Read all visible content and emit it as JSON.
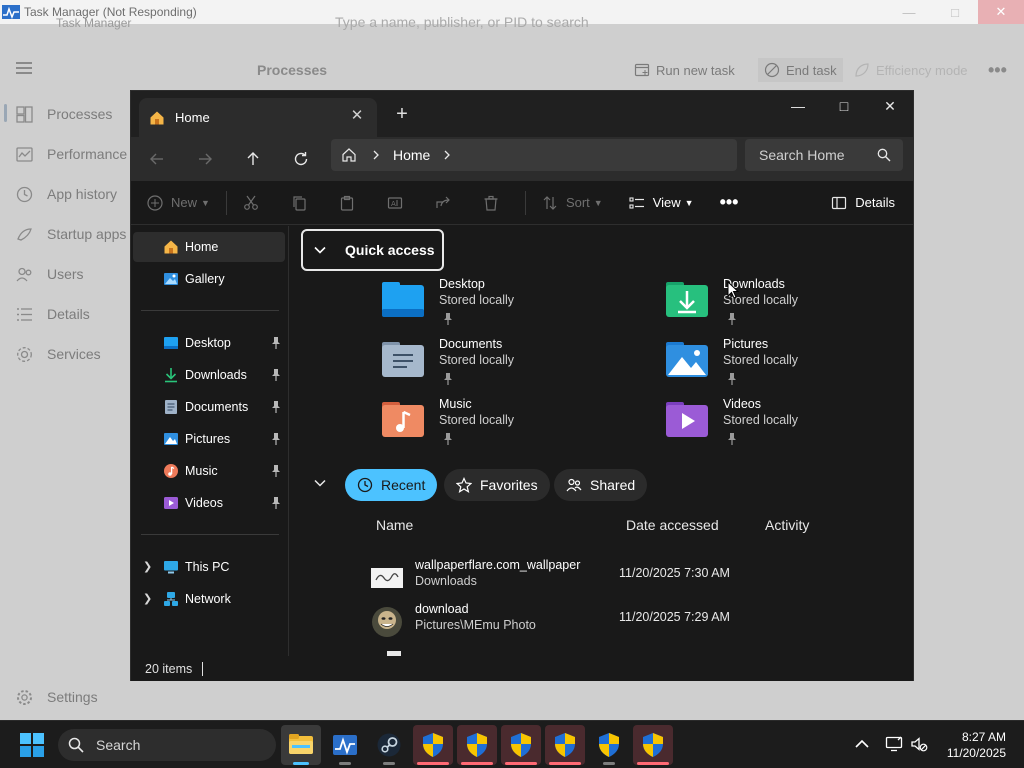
{
  "task_manager": {
    "title": "Task Manager (Not Responding)",
    "ghost_app_name": "Task Manager",
    "search_placeholder": "Type a name, publisher, or PID to search",
    "page_title": "Processes",
    "toolbar": {
      "run_new_task": "Run new task",
      "end_task": "End task",
      "efficiency_mode": "Efficiency mode"
    },
    "nav": [
      {
        "label": "Processes",
        "icon": "processes-icon"
      },
      {
        "label": "Performance",
        "icon": "performance-icon"
      },
      {
        "label": "App history",
        "icon": "app-history-icon"
      },
      {
        "label": "Startup apps",
        "icon": "startup-icon"
      },
      {
        "label": "Users",
        "icon": "users-icon"
      },
      {
        "label": "Details",
        "icon": "details-icon"
      },
      {
        "label": "Services",
        "icon": "services-icon"
      }
    ],
    "settings_label": "Settings"
  },
  "explorer": {
    "tab_title": "Home",
    "breadcrumb": "Home",
    "search_placeholder": "Search Home",
    "commands": {
      "new": "New",
      "sort": "Sort",
      "view": "View",
      "details": "Details"
    },
    "sidebar": {
      "top": [
        {
          "label": "Home",
          "icon": "home-icon"
        },
        {
          "label": "Gallery",
          "icon": "gallery-icon"
        }
      ],
      "pinned": [
        {
          "label": "Desktop",
          "icon": "desktop-folder-icon"
        },
        {
          "label": "Downloads",
          "icon": "downloads-folder-icon"
        },
        {
          "label": "Documents",
          "icon": "documents-folder-icon"
        },
        {
          "label": "Pictures",
          "icon": "pictures-folder-icon"
        },
        {
          "label": "Music",
          "icon": "music-folder-icon"
        },
        {
          "label": "Videos",
          "icon": "videos-folder-icon"
        }
      ],
      "devices": [
        {
          "label": "This PC",
          "icon": "this-pc-icon"
        },
        {
          "label": "Network",
          "icon": "network-icon"
        }
      ]
    },
    "quick_access": {
      "title": "Quick access",
      "folders": [
        {
          "name": "Desktop",
          "sub": "Stored locally"
        },
        {
          "name": "Downloads",
          "sub": "Stored locally"
        },
        {
          "name": "Documents",
          "sub": "Stored locally"
        },
        {
          "name": "Pictures",
          "sub": "Stored locally"
        },
        {
          "name": "Music",
          "sub": "Stored locally"
        },
        {
          "name": "Videos",
          "sub": "Stored locally"
        }
      ]
    },
    "filters": {
      "recent": "Recent",
      "favorites": "Favorites",
      "shared": "Shared"
    },
    "columns": {
      "name": "Name",
      "date": "Date accessed",
      "activity": "Activity"
    },
    "files": [
      {
        "name": "wallpaperflare.com_wallpaper",
        "location": "Downloads",
        "date": "11/20/2025 7:30 AM"
      },
      {
        "name": "download",
        "location": "Pictures\\MEmu Photo",
        "date": "11/20/2025 7:29 AM"
      }
    ],
    "status": "20 items"
  },
  "taskbar": {
    "search_placeholder": "Search",
    "time": "8:27 AM",
    "date": "11/20/2025"
  },
  "colors": {
    "accent": "#4cc2ff",
    "explorer_bg": "#191919",
    "taskbar_bg": "#1c1c1c",
    "shield_yellow": "#f7c400",
    "shield_blue": "#1f6fd6"
  }
}
